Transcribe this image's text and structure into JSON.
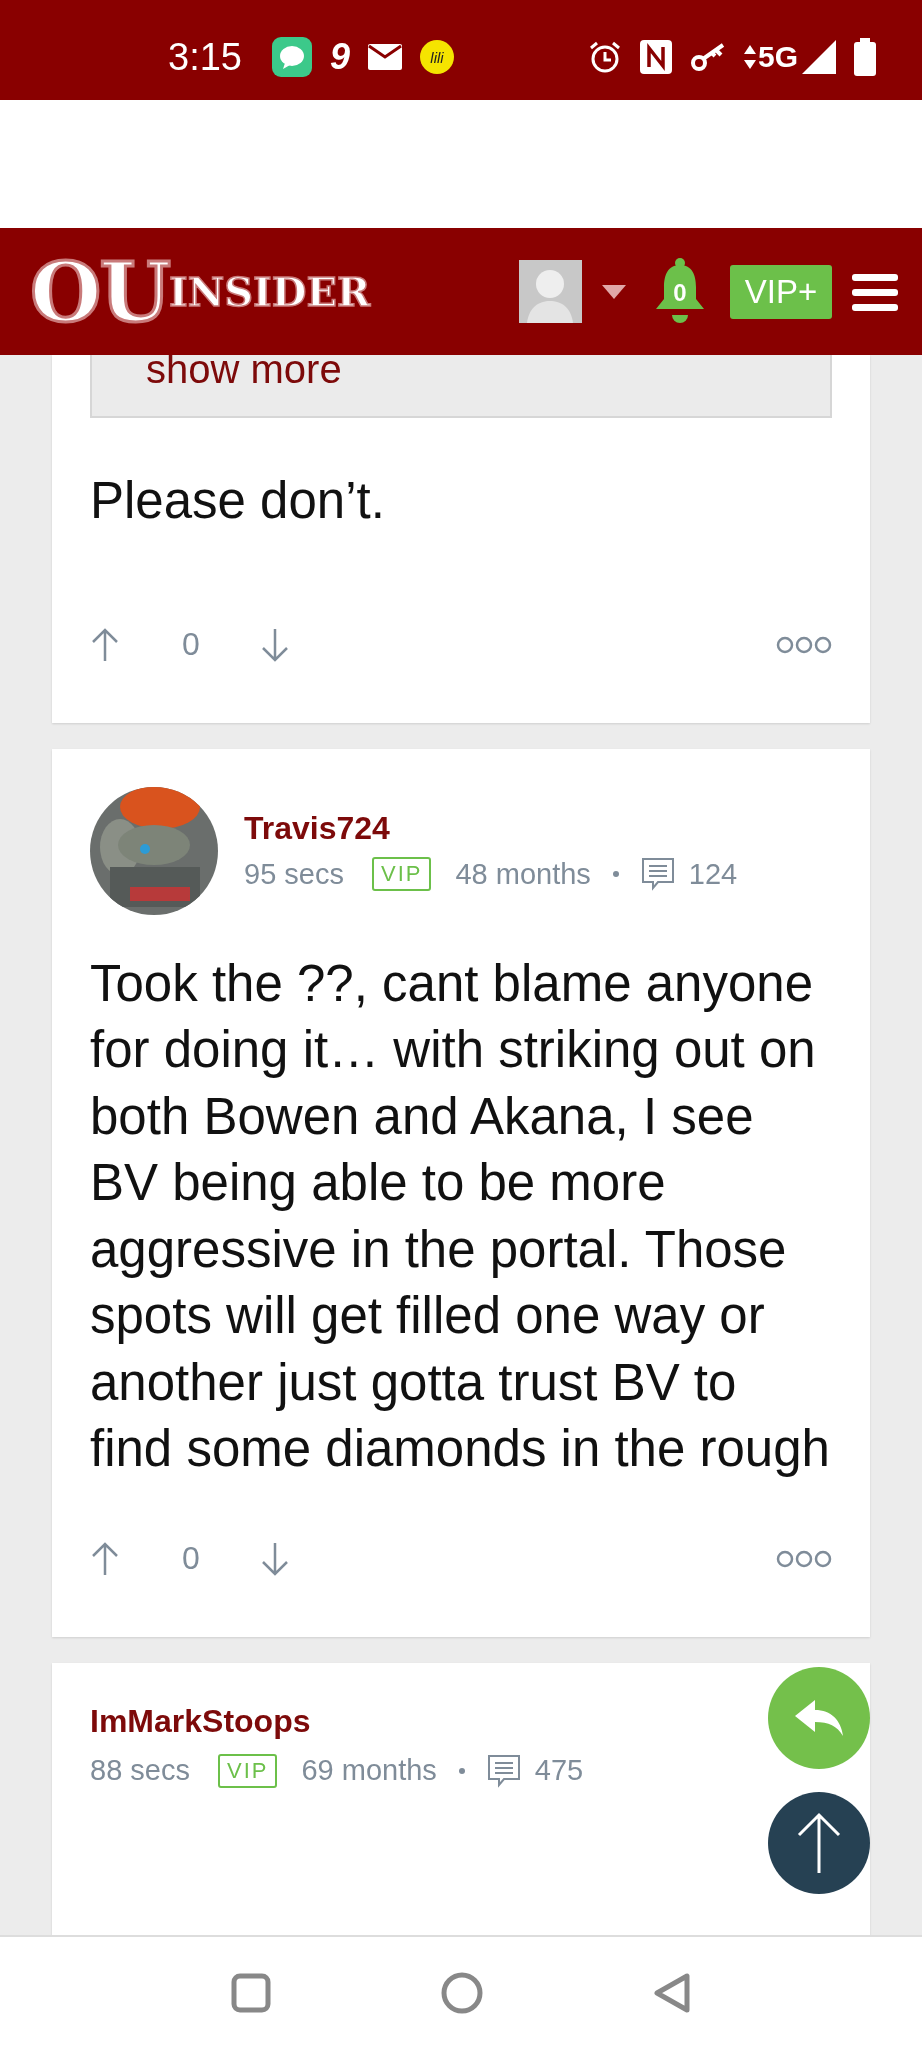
{
  "status_bar": {
    "time": "3:15",
    "app_badge": "9",
    "app_label": "lili",
    "network": "5G"
  },
  "header": {
    "logo_main": "OU",
    "logo_sub": "INSIDER",
    "notifications": "0",
    "vip_button": "VIP+"
  },
  "comments": [
    {
      "kind": "partial",
      "show_more": "show more",
      "body": "Please don’t.",
      "votes": "0"
    },
    {
      "kind": "full",
      "username": "Travis724",
      "time": "95 secs",
      "badge": "VIP",
      "tenure": "48 months",
      "posts": "124",
      "body": "Took the ??, cant blame anyone for doing it… with striking out on both Bowen and Akana, I see BV being able to be more aggressive in the portal. Those spots will get filled one way or another just gotta trust BV to find some diamonds in the rough",
      "votes": "0"
    },
    {
      "kind": "header_only",
      "username": "ImMarkStoops",
      "time": "88 secs",
      "badge": "VIP",
      "tenure": "69 months",
      "posts": "475"
    }
  ]
}
